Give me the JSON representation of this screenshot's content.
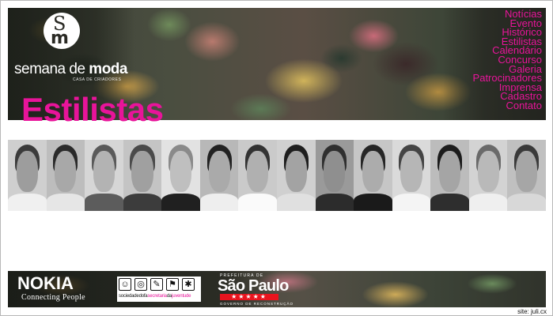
{
  "brand": {
    "logo_letters": {
      "s": "S",
      "m": "m"
    },
    "name_light": "semana de ",
    "name_bold": "moda",
    "subtitle": "CASA DE CRIADORES"
  },
  "page": {
    "title": "Estilistas",
    "accent_color": "#e8149a"
  },
  "nav": {
    "items": [
      {
        "label": "Notícias"
      },
      {
        "label": "Evento"
      },
      {
        "label": "Histórico"
      },
      {
        "label": "Estilistas"
      },
      {
        "label": "Calendário"
      },
      {
        "label": "Concurso"
      },
      {
        "label": "Galeria"
      },
      {
        "label": "Patrocinadores"
      },
      {
        "label": "Imprensa"
      },
      {
        "label": "Cadastro"
      },
      {
        "label": "Contato"
      }
    ]
  },
  "designers": {
    "count": 14
  },
  "footer": {
    "nokia": {
      "logo": "NOKIA",
      "tagline": "Connecting People"
    },
    "secretaria": {
      "icons": [
        "smiley-icon",
        "target-icon",
        "brush-icon",
        "flag-icon",
        "figure-icon"
      ],
      "text_a": "sociedade",
      "text_b": "dofa",
      "text_c": "secretaria",
      "text_d": "da",
      "text_e": "juventude"
    },
    "sao_paulo": {
      "top": "PREFEITURA DE",
      "title": "São Paulo",
      "stars": "★★★★★",
      "bottom": "GOVERNO DE RECONSTRUÇÃO",
      "star_color": "#e8141e"
    }
  },
  "credit": "site: juli.cx"
}
